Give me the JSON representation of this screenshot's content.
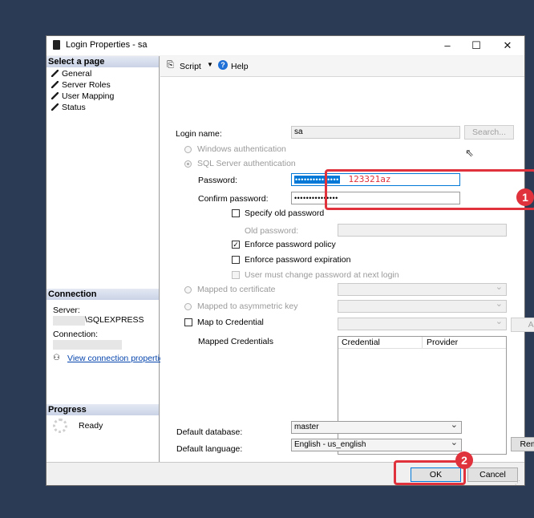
{
  "window": {
    "title": "Login Properties - sa",
    "minimize": "–",
    "maximize": "☐",
    "close": "✕"
  },
  "sidebar": {
    "select_page_title": "Select a page",
    "pages": [
      "General",
      "Server Roles",
      "User Mapping",
      "Status"
    ],
    "connection_title": "Connection",
    "server_label": "Server:",
    "server_value": "\\SQLEXPRESS",
    "connection_label": "Connection:",
    "view_connection_link": "View connection properties",
    "progress_title": "Progress",
    "progress_status": "Ready"
  },
  "toolbar": {
    "script_label": "Script",
    "help_label": "Help"
  },
  "form": {
    "login_name_label": "Login name:",
    "login_name_value": "sa",
    "search_button": "Search...",
    "windows_auth": "Windows authentication",
    "sql_auth": "SQL Server authentication",
    "password_label": "Password:",
    "password_value": "•••••••••••••••",
    "password_annotation": "123321az",
    "confirm_password_label": "Confirm password:",
    "confirm_password_value": "•••••••••••••••",
    "specify_old_password": "Specify old password",
    "old_password_label": "Old password:",
    "enforce_policy": "Enforce password policy",
    "enforce_expiration": "Enforce password expiration",
    "must_change": "User must change password at next login",
    "mapped_to_certificate": "Mapped to certificate",
    "mapped_to_asymmetric_key": "Mapped to asymmetric key",
    "map_to_credential": "Map to Credential",
    "add_button": "Add",
    "mapped_credentials_label": "Mapped Credentials",
    "col_credential": "Credential",
    "col_provider": "Provider",
    "remove_button": "Remove",
    "default_database_label": "Default database:",
    "default_database_value": "master",
    "default_language_label": "Default language:",
    "default_language_value": "English - us_english"
  },
  "footer": {
    "ok_button": "OK",
    "cancel_button": "Cancel"
  },
  "annotations": {
    "badge_1": "1",
    "badge_2": "2",
    "highlight_color": "#e0323c"
  }
}
